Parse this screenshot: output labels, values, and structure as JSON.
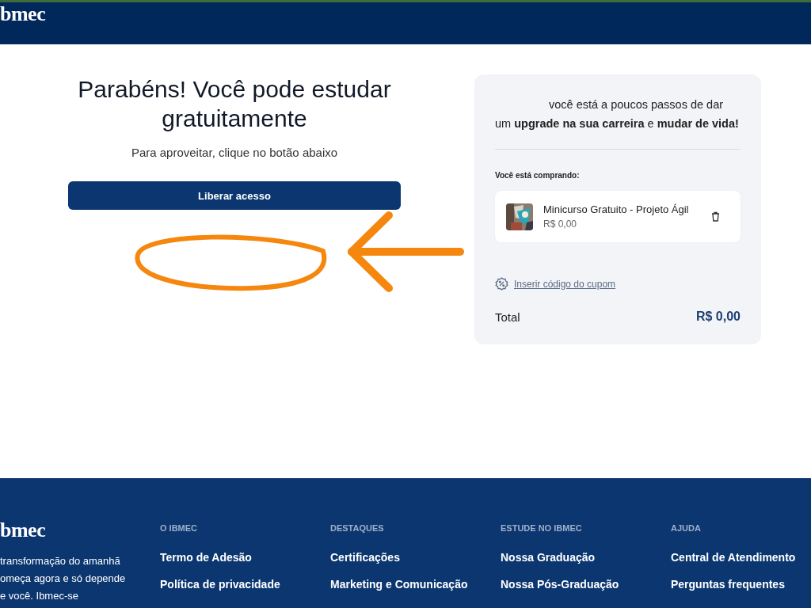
{
  "header": {
    "logo": "bmec"
  },
  "hero": {
    "title": "Parabéns! Você pode estudar gratuitamente",
    "subtitle": "Para aproveitar, clique no botão abaixo",
    "button": "Liberar acesso"
  },
  "order": {
    "intro": "você está a poucos passos de dar um **upgrade na sua carreira** e **mudar de vida!**",
    "buying_label": "Você está comprando:",
    "items": [
      {
        "kind": "picture",
        "title": "Minicurso Gratuito - Projeto Ágil",
        "price": "R$ 0,00"
      }
    ],
    "coupon_link": "Inserir código do cupom",
    "total_label": "Total",
    "total_value": "R$ 0,00"
  },
  "footer": {
    "logo": "bmec",
    "tagline": [
      "transformação do amanhã",
      "omeça agora e só depende",
      "e você. Ibmec-se"
    ],
    "columns": [
      {
        "heading": "O IBMEC",
        "links": [
          "Termo de Adesão",
          "Política de privacidade"
        ]
      },
      {
        "heading": "DESTAQUES",
        "links": [
          "Certificações",
          "Marketing e Comunicação"
        ]
      },
      {
        "heading": "ESTUDE NO IBMEC",
        "links": [
          "Nossa Graduação",
          "Nossa Pós-Graduação"
        ]
      },
      {
        "heading": "AJUDA",
        "links": [
          "Central de Atendimento",
          "Perguntas frequentes"
        ]
      }
    ]
  }
}
